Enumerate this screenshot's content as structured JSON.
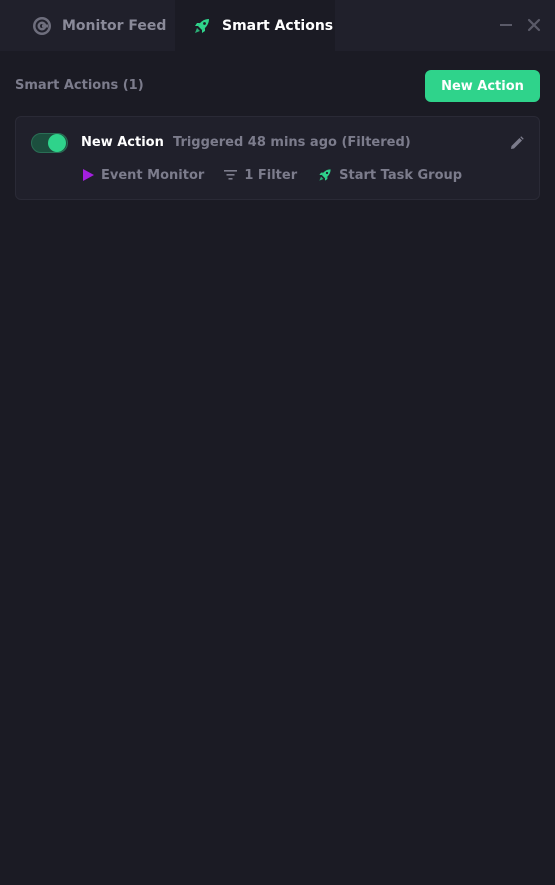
{
  "tabs": [
    {
      "label": "Monitor Feed",
      "icon": "monitor-feed-icon"
    },
    {
      "label": "Smart Actions",
      "icon": "rocket-icon",
      "active": true
    }
  ],
  "window_controls": {
    "minimize_icon": "minimize-icon",
    "close_icon": "close-icon"
  },
  "header": {
    "title": "Smart Actions (1)",
    "new_action_label": "New Action"
  },
  "actions": [
    {
      "enabled": true,
      "name": "New Action",
      "status": "Triggered 48 mins ago (Filtered)",
      "trigger": "Event Monitor",
      "filter": "1 Filter",
      "result": "Start Task Group",
      "edit_icon": "pencil-icon"
    }
  ],
  "colors": {
    "accent": "#2fd38b",
    "trigger_icon": "#a41fe0",
    "background": "#1b1b24",
    "card": "#20202b",
    "muted_text": "#7c7c8c"
  }
}
